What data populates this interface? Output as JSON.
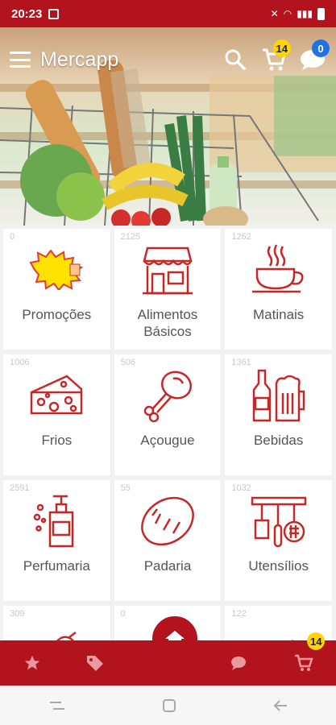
{
  "status_bar": {
    "time": "20:23"
  },
  "header": {
    "title": "Mercapp",
    "cart_badge": "14",
    "chat_badge": "0"
  },
  "categories": [
    {
      "count": "0",
      "label": "Promoções",
      "icon": "promo-splash-icon"
    },
    {
      "count": "2125",
      "label": "Alimentos Básicos",
      "icon": "storefront-icon"
    },
    {
      "count": "1262",
      "label": "Matinais",
      "icon": "coffee-cup-icon"
    },
    {
      "count": "1006",
      "label": "Frios",
      "icon": "cheese-icon"
    },
    {
      "count": "506",
      "label": "Açougue",
      "icon": "meat-leg-icon"
    },
    {
      "count": "1361",
      "label": "Bebidas",
      "icon": "beer-bottle-icon"
    },
    {
      "count": "2591",
      "label": "Perfumaria",
      "icon": "soap-dispenser-icon"
    },
    {
      "count": "55",
      "label": "Padaria",
      "icon": "bread-icon"
    },
    {
      "count": "1032",
      "label": "Utensílios",
      "icon": "kitchen-utensils-icon"
    },
    {
      "count": "309",
      "label": "",
      "icon": "baby-bottle-icon"
    },
    {
      "count": "0",
      "label": "",
      "icon": "baby-clothes-icon"
    },
    {
      "count": "122",
      "label": "",
      "icon": "garden-tools-icon"
    }
  ],
  "bottom_nav": {
    "cart_badge": "14"
  },
  "colors": {
    "primary": "#b2131d",
    "badge_yellow": "#ffd400",
    "badge_blue": "#2070e6"
  }
}
